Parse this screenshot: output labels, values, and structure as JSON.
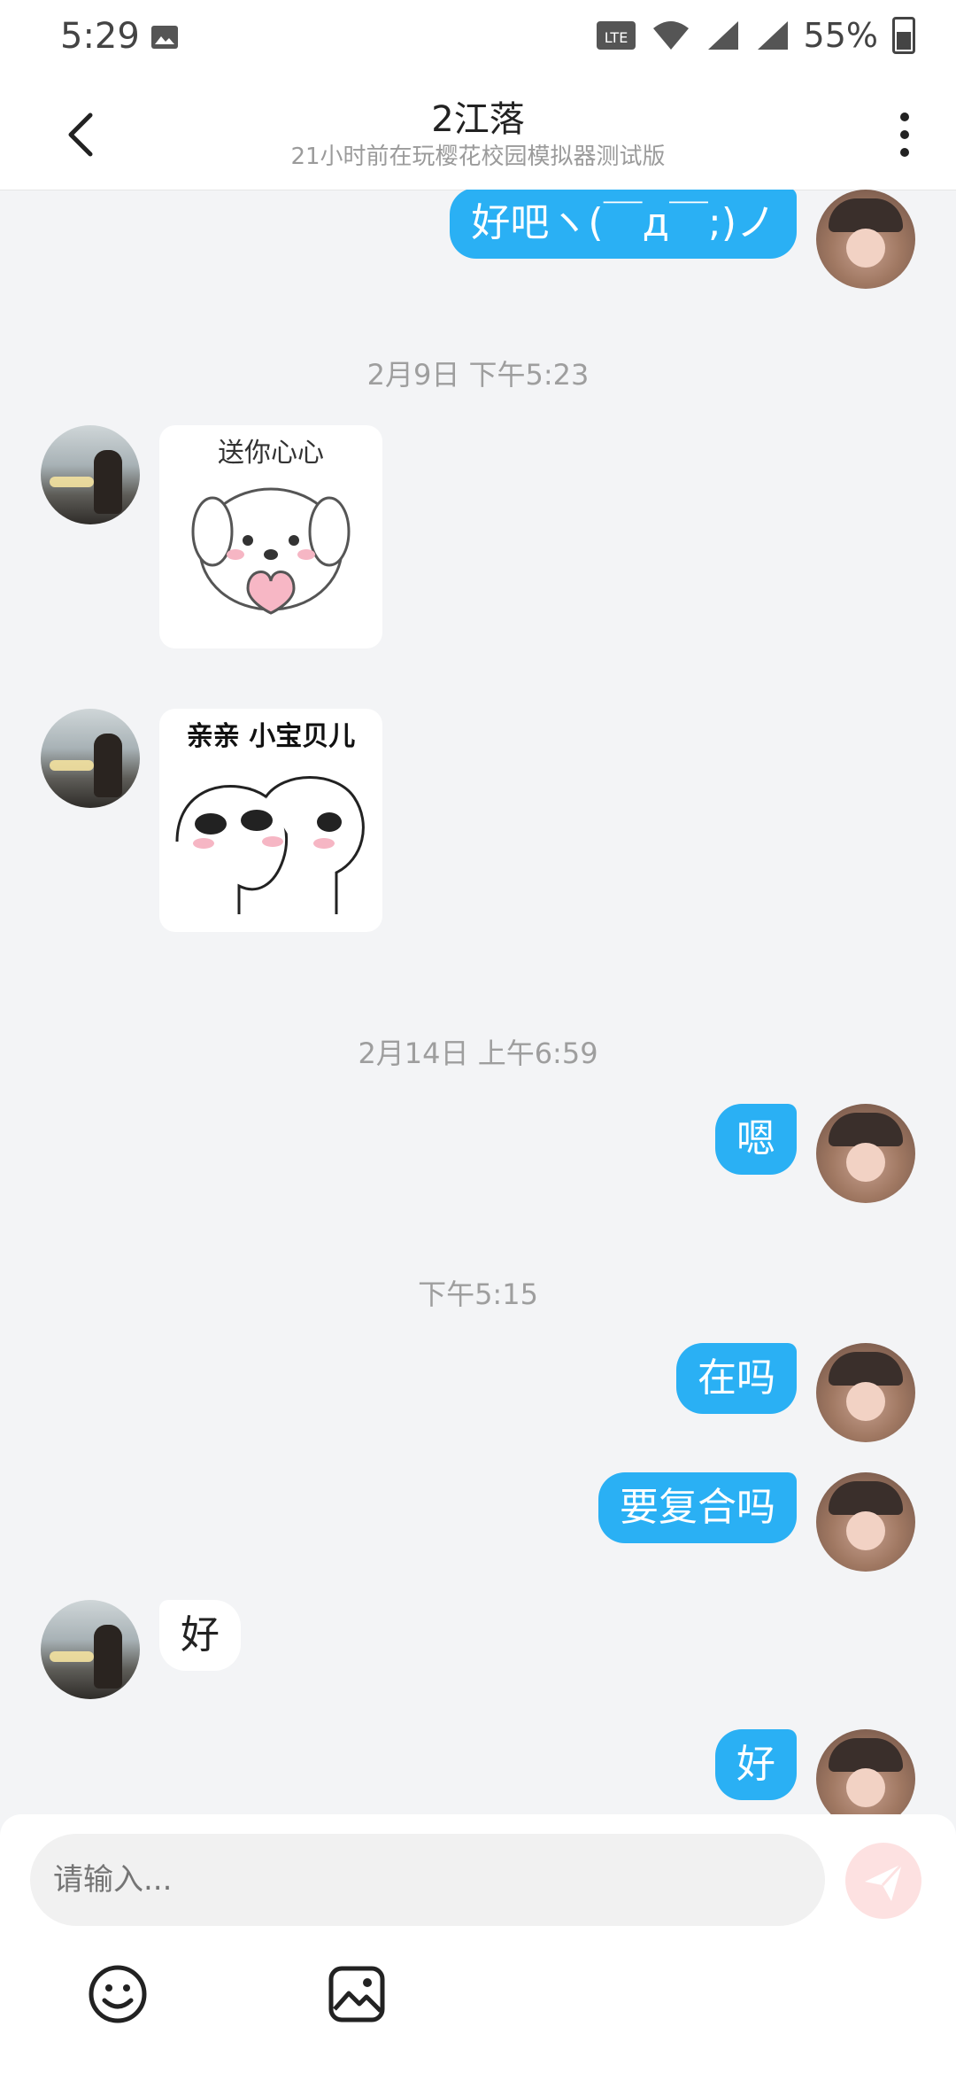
{
  "status_bar": {
    "time": "5:29",
    "battery": "55%",
    "network": "4G",
    "network_label": "G"
  },
  "header": {
    "title": "2江落",
    "subtitle": "21小时前在玩樱花校园模拟器测试版"
  },
  "messages": {
    "m1": "好吧ヽ(￣д￣;)ノ",
    "ts1": "2月9日 下午5:23",
    "sticker1_caption": "送你心心",
    "sticker2_caption": "亲亲 小宝贝儿",
    "ts2": "2月14日 上午6:59",
    "m2": "嗯",
    "ts3": "下午5:15",
    "m3": "在吗",
    "m4": "要复合吗",
    "m5": "好",
    "m6": "好"
  },
  "input": {
    "placeholder": "请输入..."
  },
  "colors": {
    "accent": "#2ab0f4",
    "send_disabled": "#fde1e1"
  }
}
